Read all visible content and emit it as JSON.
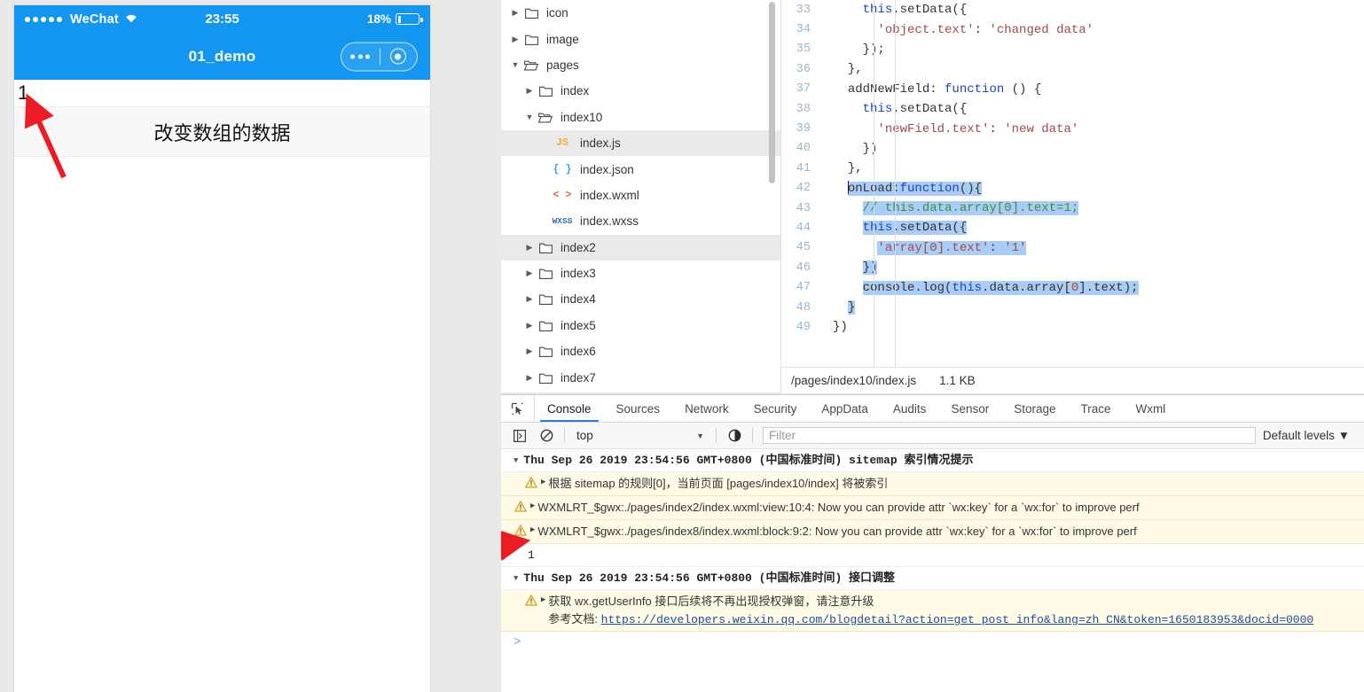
{
  "simulator": {
    "status_bar": {
      "signal_dots": 5,
      "carrier": "WeChat",
      "wifi_icon": "wifi-icon",
      "time": "23:55",
      "battery_percent": "18%",
      "battery_level": 18
    },
    "nav_bar": {
      "title": "01_demo",
      "menu_icon": "ellipsis-icon",
      "target_icon": "target-icon"
    },
    "page": {
      "value_row": "1",
      "button_row": "改变数组的数据"
    }
  },
  "file_tree": {
    "items": [
      {
        "label": "icon",
        "icon": "folder-closed-icon",
        "twisty": "collapsed",
        "indent": 0,
        "type": "folder",
        "selected": false
      },
      {
        "label": "image",
        "icon": "folder-closed-icon",
        "twisty": "collapsed",
        "indent": 0,
        "type": "folder",
        "selected": false
      },
      {
        "label": "pages",
        "icon": "folder-open-icon",
        "twisty": "expanded",
        "indent": 0,
        "type": "folder",
        "selected": false
      },
      {
        "label": "index",
        "icon": "folder-closed-icon",
        "twisty": "collapsed",
        "indent": 1,
        "type": "folder",
        "selected": false
      },
      {
        "label": "index10",
        "icon": "folder-open-icon",
        "twisty": "expanded",
        "indent": 1,
        "type": "folder",
        "selected": false
      },
      {
        "label": "index.js",
        "icon": "js-file-icon",
        "twisty": "none",
        "indent": 2,
        "type": "js",
        "ext": "JS",
        "selected": true
      },
      {
        "label": "index.json",
        "icon": "json-file-icon",
        "twisty": "none",
        "indent": 2,
        "type": "json",
        "ext": "{ }",
        "selected": false
      },
      {
        "label": "index.wxml",
        "icon": "wxml-file-icon",
        "twisty": "none",
        "indent": 2,
        "type": "wxml",
        "ext": "< >",
        "selected": false
      },
      {
        "label": "index.wxss",
        "icon": "wxss-file-icon",
        "twisty": "none",
        "indent": 2,
        "type": "wxss",
        "ext": "WXSS",
        "selected": false
      },
      {
        "label": "index2",
        "icon": "folder-closed-icon",
        "twisty": "collapsed",
        "indent": 1,
        "type": "folder",
        "selected": true
      },
      {
        "label": "index3",
        "icon": "folder-closed-icon",
        "twisty": "collapsed",
        "indent": 1,
        "type": "folder",
        "selected": false
      },
      {
        "label": "index4",
        "icon": "folder-closed-icon",
        "twisty": "collapsed",
        "indent": 1,
        "type": "folder",
        "selected": false
      },
      {
        "label": "index5",
        "icon": "folder-closed-icon",
        "twisty": "collapsed",
        "indent": 1,
        "type": "folder",
        "selected": false
      },
      {
        "label": "index6",
        "icon": "folder-closed-icon",
        "twisty": "collapsed",
        "indent": 1,
        "type": "folder",
        "selected": false
      },
      {
        "label": "index7",
        "icon": "folder-closed-icon",
        "twisty": "collapsed",
        "indent": 1,
        "type": "folder",
        "selected": false
      }
    ]
  },
  "editor": {
    "first_line_number": 33,
    "lines": [
      {
        "n": 33,
        "indent": 4,
        "text": "this.setData({",
        "hl": false
      },
      {
        "n": 34,
        "indent": 6,
        "text": "'object.text': 'changed data'",
        "hl": false
      },
      {
        "n": 35,
        "indent": 4,
        "text": "});",
        "hl": false
      },
      {
        "n": 36,
        "indent": 2,
        "text": "},",
        "hl": false
      },
      {
        "n": 37,
        "indent": 2,
        "text": "addNewField: function () {",
        "hl": false
      },
      {
        "n": 38,
        "indent": 4,
        "text": "this.setData({",
        "hl": false
      },
      {
        "n": 39,
        "indent": 6,
        "text": "'newField.text': 'new data'",
        "hl": false
      },
      {
        "n": 40,
        "indent": 4,
        "text": "})",
        "hl": false
      },
      {
        "n": 41,
        "indent": 2,
        "text": "},",
        "hl": false
      },
      {
        "n": 42,
        "indent": 2,
        "text": "onLoad:function(){",
        "hl": true
      },
      {
        "n": 43,
        "indent": 4,
        "text": "// this.data.array[0].text=1;",
        "hl": true
      },
      {
        "n": 44,
        "indent": 4,
        "text": "this.setData({",
        "hl": true
      },
      {
        "n": 45,
        "indent": 6,
        "text": "'array[0].text': '1'",
        "hl": true
      },
      {
        "n": 46,
        "indent": 4,
        "text": "})",
        "hl": true
      },
      {
        "n": 47,
        "indent": 4,
        "text": "console.log(this.data.array[0].text);",
        "hl": true
      },
      {
        "n": 48,
        "indent": 2,
        "text": "}",
        "hl": true
      },
      {
        "n": 49,
        "indent": 0,
        "text": "})",
        "hl": false
      }
    ],
    "status": {
      "path": "/pages/index10/index.js",
      "size": "1.1 KB"
    }
  },
  "devtools": {
    "inspect_icon": "inspect-element-icon",
    "tabs": [
      {
        "label": "Console",
        "active": true
      },
      {
        "label": "Sources",
        "active": false
      },
      {
        "label": "Network",
        "active": false
      },
      {
        "label": "Security",
        "active": false
      },
      {
        "label": "AppData",
        "active": false
      },
      {
        "label": "Audits",
        "active": false
      },
      {
        "label": "Sensor",
        "active": false
      },
      {
        "label": "Storage",
        "active": false
      },
      {
        "label": "Trace",
        "active": false
      },
      {
        "label": "Wxml",
        "active": false
      }
    ],
    "toolbar": {
      "sidebar_icon": "show-console-sidebar-icon",
      "clear_icon": "clear-console-icon",
      "context": "top",
      "context_arrow": "chevron-down-icon",
      "eye_icon": "live-expression-icon",
      "filter_placeholder": "Filter",
      "filter_value": "",
      "levels": "Default levels",
      "levels_arrow": "chevron-down-icon"
    },
    "messages": [
      {
        "kind": "group",
        "twisty": "expanded",
        "text": "Thu Sep 26 2019 23:54:56 GMT+0800 (中国标准时间) sitemap 索引情况提示"
      },
      {
        "kind": "warning",
        "indented": true,
        "icon": "warning-icon",
        "twisty": "collapsed",
        "text": "根据 sitemap 的规则[0]，当前页面 [pages/index10/index] 将被索引"
      },
      {
        "kind": "warning",
        "indented": false,
        "icon": "warning-icon",
        "twisty": "collapsed",
        "text": "WXMLRT_$gwx:./pages/index2/index.wxml:view:10:4: Now you can provide attr `wx:key` for a `wx:for` to improve perf"
      },
      {
        "kind": "warning",
        "indented": false,
        "icon": "warning-icon",
        "twisty": "collapsed",
        "text": "WXMLRT_$gwx:./pages/index8/index.wxml:block:9:2: Now you can provide attr `wx:key` for a `wx:for` to improve perf"
      },
      {
        "kind": "log",
        "text": "1"
      },
      {
        "kind": "group",
        "twisty": "expanded",
        "text": "Thu Sep 26 2019 23:54:56 GMT+0800 (中国标准时间) 接口调整"
      },
      {
        "kind": "warning",
        "indented": true,
        "icon": "warning-icon",
        "twisty": "collapsed",
        "text": "获取 wx.getUserInfo 接口后续将不再出现授权弹窗，请注意升级",
        "second_line_label": "参考文档: ",
        "second_line_link": "https://developers.weixin.qq.com/blogdetail?action=get_post_info&lang=zh_CN&token=1650183953&docid=0000"
      }
    ],
    "prompt": ">"
  },
  "annotations": {
    "arrow_color": "#ed1c24",
    "arrow_simulator_target": "value-row-1",
    "arrow_console_target": "console-log-1"
  }
}
